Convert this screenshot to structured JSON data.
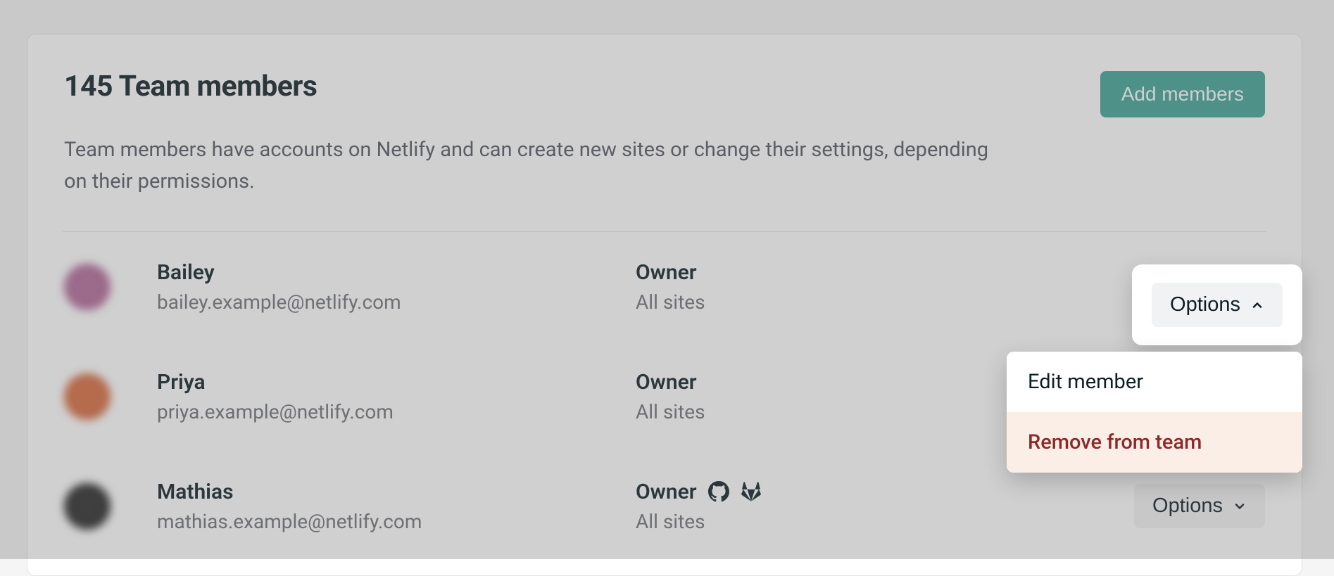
{
  "header": {
    "title": "145 Team members",
    "add_button": "Add members",
    "description": "Team members have accounts on Netlify and can create new sites or change their settings, depending on their permissions."
  },
  "options_label": "Options",
  "members": [
    {
      "name": "Bailey",
      "email": "bailey.example@netlify.com",
      "role": "Owner",
      "scope": "All sites",
      "avatar_color": "purple",
      "providers": []
    },
    {
      "name": "Priya",
      "email": "priya.example@netlify.com",
      "role": "Owner",
      "scope": "All sites",
      "avatar_color": "orange",
      "providers": []
    },
    {
      "name": "Mathias",
      "email": "mathias.example@netlify.com",
      "role": "Owner",
      "scope": "All sites",
      "avatar_color": "dark",
      "providers": [
        "github",
        "gitlab"
      ]
    }
  ],
  "dropdown": {
    "edit": "Edit member",
    "remove": "Remove from team"
  }
}
